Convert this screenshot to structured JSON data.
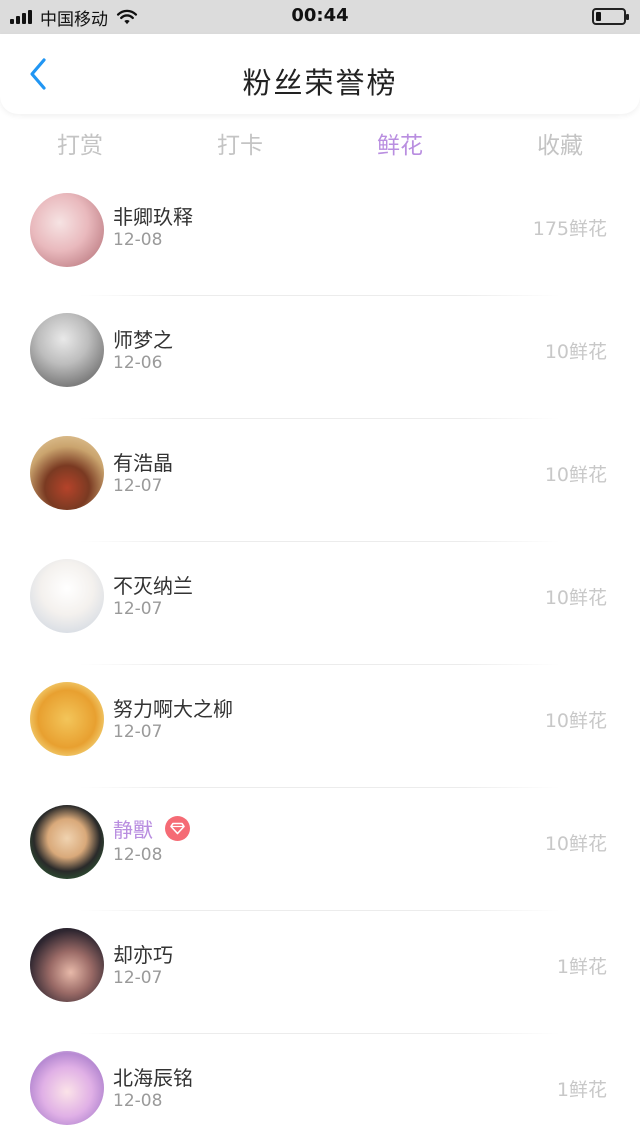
{
  "status_bar": {
    "carrier": "中国移动",
    "time": "00:44"
  },
  "header": {
    "title": "粉丝荣誉榜"
  },
  "tabs": [
    {
      "label": "打赏",
      "active": false
    },
    {
      "label": "打卡",
      "active": false
    },
    {
      "label": "鲜花",
      "active": true
    },
    {
      "label": "收藏",
      "active": false
    }
  ],
  "colors": {
    "accent": "#b98ee0",
    "back": "#2196f3",
    "badge": "#f56b75",
    "muted": "#c8c8c8"
  },
  "fans": [
    {
      "name": "非卿玖释",
      "date": "12-08",
      "count": "175鲜花"
    },
    {
      "name": "师梦之",
      "date": "12-06",
      "count": "10鲜花"
    },
    {
      "name": "有浩晶",
      "date": "12-07",
      "count": "10鲜花"
    },
    {
      "name": "不灭纳兰",
      "date": "12-07",
      "count": "10鲜花"
    },
    {
      "name": "努力啊大之柳",
      "date": "12-07",
      "count": "10鲜花"
    },
    {
      "name": "静獸",
      "date": "12-08",
      "count": "10鲜花",
      "vip": true,
      "badge_icon": "diamond-icon"
    },
    {
      "name": "却亦巧",
      "date": "12-07",
      "count": "1鲜花"
    },
    {
      "name": "北海辰铭",
      "date": "12-08",
      "count": "1鲜花"
    }
  ]
}
